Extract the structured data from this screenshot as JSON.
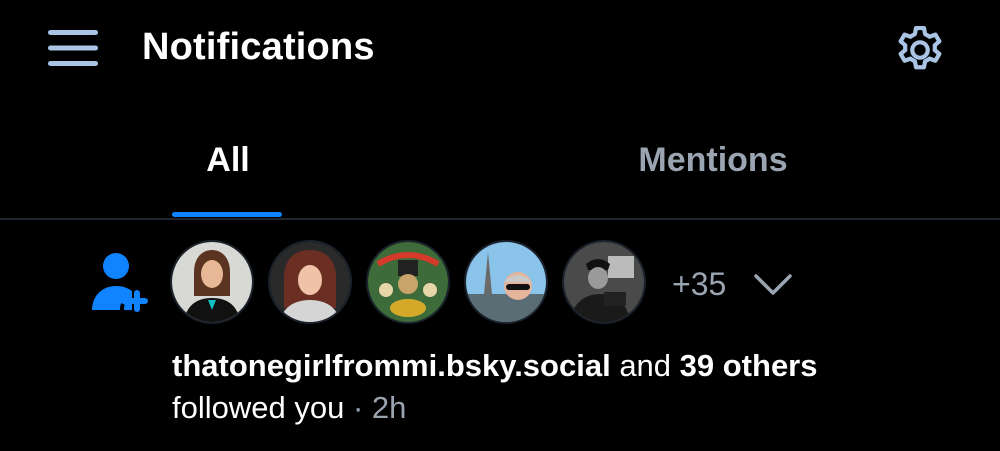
{
  "header": {
    "title": "Notifications",
    "menu_icon": "hamburger-menu-icon",
    "settings_icon": "gear-icon"
  },
  "tabs": [
    {
      "label": "All",
      "active": true
    },
    {
      "label": "Mentions",
      "active": false
    }
  ],
  "notification": {
    "type_icon": "person-add-icon",
    "avatars": [
      {
        "name": "avatar-1"
      },
      {
        "name": "avatar-2"
      },
      {
        "name": "avatar-3"
      },
      {
        "name": "avatar-4"
      },
      {
        "name": "avatar-5"
      }
    ],
    "more_count": "+35",
    "expand_icon": "chevron-down-icon",
    "handle": "thatonegirlfrommi.bsky.social",
    "connector": " and ",
    "others": "39 others",
    "action": "followed you",
    "separator": " · ",
    "time": "2h"
  },
  "colors": {
    "background": "#000000",
    "accent": "#1083fe",
    "muted": "#9aa5b1",
    "divider": "#1f2630",
    "icon": "#a9c4e4"
  }
}
